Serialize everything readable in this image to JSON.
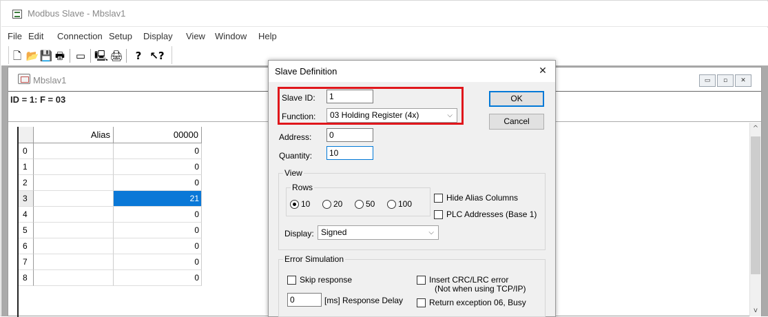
{
  "app": {
    "title": "Modbus Slave - Mbslav1"
  },
  "menu": [
    "File",
    "Edit",
    "Connection",
    "Setup",
    "Display",
    "View",
    "Window",
    "Help"
  ],
  "toolbar": {
    "buttons": [
      {
        "name": "new-icon",
        "glyph": "🗋"
      },
      {
        "name": "open-icon",
        "glyph": "📂"
      },
      {
        "name": "save-icon",
        "glyph": "💾"
      },
      {
        "name": "print-icon",
        "glyph": "🖶"
      },
      {
        "name": "window-icon",
        "glyph": "▭"
      },
      {
        "name": "connect-icon",
        "glyph": "🖳"
      },
      {
        "name": "disconnect-icon",
        "glyph": "🖨"
      },
      {
        "name": "about-icon",
        "glyph": "?"
      },
      {
        "name": "help-icon",
        "glyph": "↖?"
      }
    ]
  },
  "child": {
    "title": "Mbslav1",
    "id_line": "ID = 1: F = 03",
    "controls": [
      "▭",
      "▫",
      "✕"
    ]
  },
  "grid": {
    "columns": [
      "Alias",
      "00000"
    ],
    "rows": [
      {
        "n": "0",
        "val": "0"
      },
      {
        "n": "1",
        "val": "0"
      },
      {
        "n": "2",
        "val": "0"
      },
      {
        "n": "3",
        "val": "21",
        "selected": true
      },
      {
        "n": "4",
        "val": "0"
      },
      {
        "n": "5",
        "val": "0"
      },
      {
        "n": "6",
        "val": "0"
      },
      {
        "n": "7",
        "val": "0"
      },
      {
        "n": "8",
        "val": "0"
      }
    ]
  },
  "scrollbar": {
    "up": "^",
    "down": "v"
  },
  "dialog": {
    "title": "Slave Definition",
    "close": "✕",
    "slave_id_label": "Slave ID:",
    "slave_id": "1",
    "function_label": "Function:",
    "function": "03 Holding Register (4x)",
    "address_label": "Address:",
    "address": "0",
    "quantity_label": "Quantity:",
    "quantity": "10",
    "ok": "OK",
    "cancel": "Cancel",
    "view_group": "View",
    "rows_group": "Rows",
    "row_options": [
      "10",
      "20",
      "50",
      "100"
    ],
    "rows_selected": "10",
    "hide_alias": "Hide Alias Columns",
    "plc_addresses": "PLC Addresses (Base 1)",
    "display_label": "Display:",
    "display": "Signed",
    "error_group": "Error Simulation",
    "skip_response": "Skip response",
    "insert_crc": "Insert CRC/LRC error",
    "insert_crc_note": "(Not when using TCP/IP)",
    "response_delay_value": "0",
    "response_delay_label": "[ms] Response Delay",
    "return_exception": "Return exception 06, Busy"
  },
  "colors": {
    "highlight": "#e0161b",
    "selection": "#0a78d7",
    "focus": "#0078d7"
  }
}
